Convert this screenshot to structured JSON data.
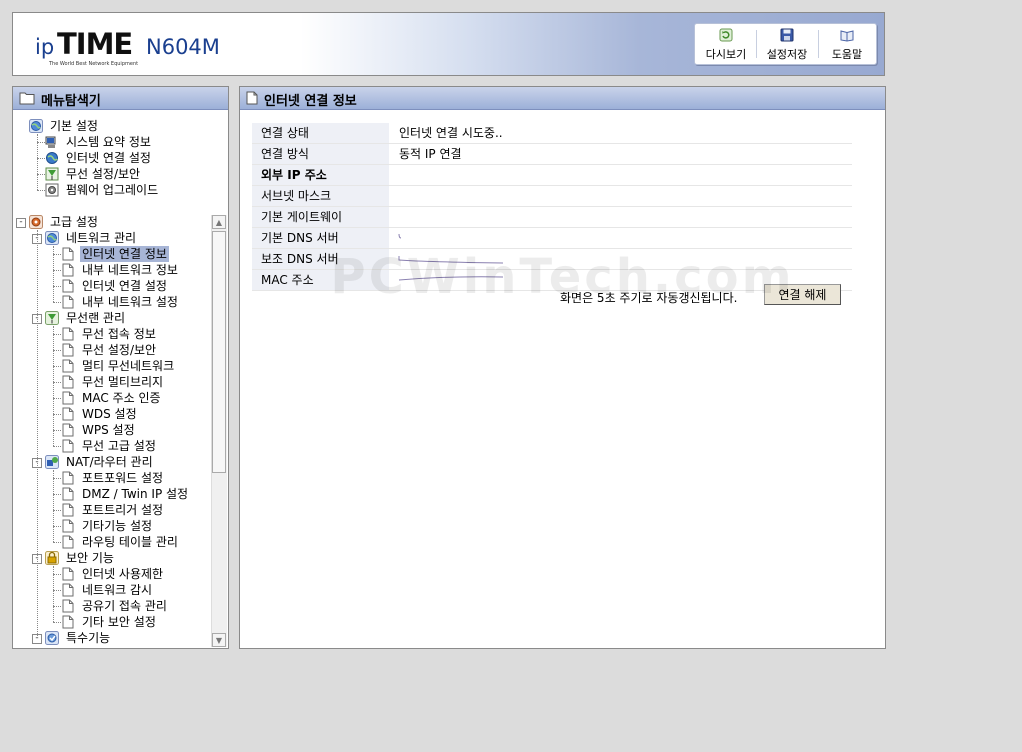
{
  "header": {
    "logo_ip": "ip",
    "logo_time": "TIME",
    "logo_tagline": "The World Best Network Equipment",
    "model": "N604M",
    "buttons": [
      {
        "label": "다시보기",
        "icon": "refresh-icon"
      },
      {
        "label": "설정저장",
        "icon": "save-disk-icon"
      },
      {
        "label": "도움말",
        "icon": "help-book-icon"
      }
    ]
  },
  "sidebar": {
    "title": "메뉴탐색기",
    "basic": {
      "label": "기본 설정",
      "items": [
        "시스템 요약 정보",
        "인터넷 연결 설정",
        "무선 설정/보안",
        "펌웨어 업그레이드"
      ]
    },
    "advanced": {
      "label": "고급 설정",
      "groups": [
        {
          "label": "네트워크 관리",
          "items": [
            "인터넷 연결 정보",
            "내부 네트워크 정보",
            "인터넷 연결 설정",
            "내부 네트워크 설정"
          ]
        },
        {
          "label": "무선랜 관리",
          "items": [
            "무선 접속 정보",
            "무선 설정/보안",
            "멀티 무선네트워크",
            "무선 멀티브리지",
            "MAC 주소 인증",
            "WDS 설정",
            "WPS 설정",
            "무선 고급 설정"
          ]
        },
        {
          "label": "NAT/라우터 관리",
          "items": [
            "포트포워드 설정",
            "DMZ / Twin IP 설정",
            "포트트리거 설정",
            "기타기능 설정",
            "라우팅 테이블 관리"
          ]
        },
        {
          "label": "보안 기능",
          "items": [
            "인터넷 사용제한",
            "네트워크 감시",
            "공유기 접속 관리",
            "기타 보안 설정"
          ]
        },
        {
          "label": "특수기능",
          "items": []
        }
      ]
    },
    "selected": "인터넷 연결 정보"
  },
  "main": {
    "title": "인터넷 연결 정보",
    "rows": [
      {
        "label": "연결 상태",
        "value": "인터넷 연결 시도중.."
      },
      {
        "label": "연결 방식",
        "value": "동적 IP 연결"
      },
      {
        "label": "외부 IP 주소",
        "value": ""
      },
      {
        "label": "서브넷 마스크",
        "value": ""
      },
      {
        "label": "기본 게이트웨이",
        "value": ""
      },
      {
        "label": "기본 DNS 서버",
        "value": ""
      },
      {
        "label": "보조 DNS 서버",
        "value": ""
      },
      {
        "label": "MAC 주소",
        "value": ""
      }
    ],
    "refresh_note": "화면은 5초 주기로 자동갱신됩니다.",
    "disconnect_label": "연결 해제"
  },
  "watermark": "PCWinTech.com",
  "colors": {
    "panel_header": "#9cb0d8",
    "selected_item": "#a7b5d6",
    "label_cell": "#eef0f6",
    "button_face": "#ebe6d8",
    "brand_blue": "#1a3f8f"
  }
}
